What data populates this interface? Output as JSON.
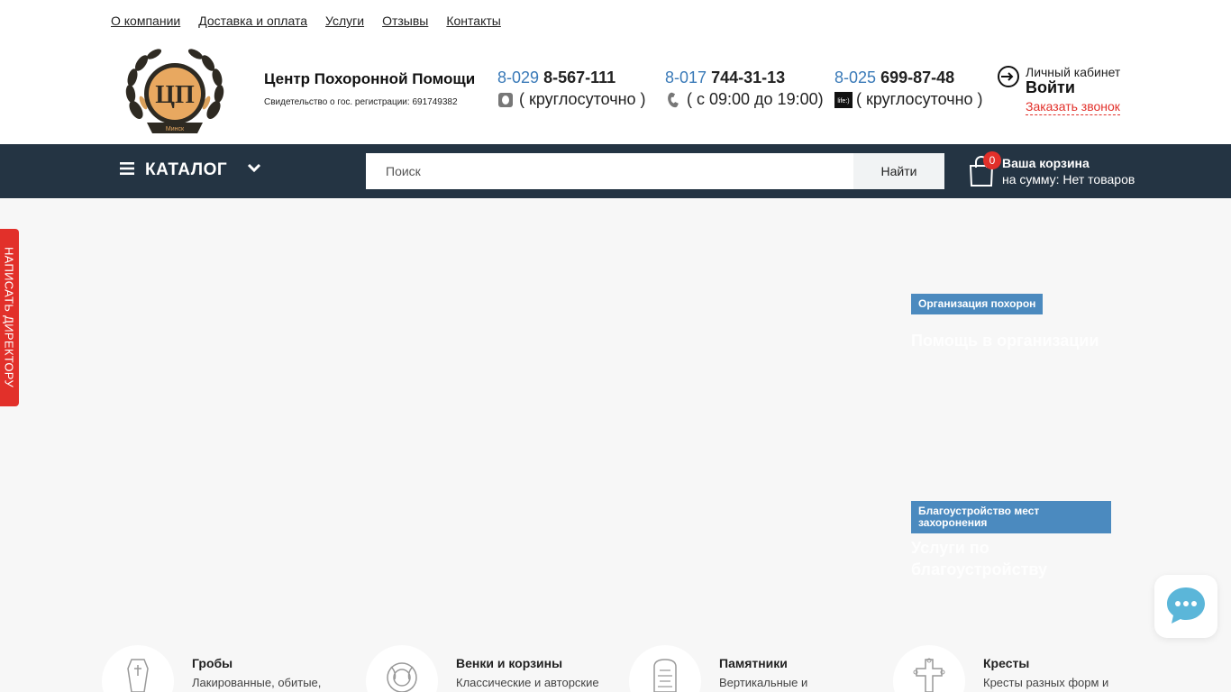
{
  "top_nav": [
    {
      "label": "О компании"
    },
    {
      "label": "Доставка и оплата"
    },
    {
      "label": "Услуги"
    },
    {
      "label": "Отзывы"
    },
    {
      "label": "Контакты"
    }
  ],
  "company": {
    "name": "Центр Похоронной Помощи",
    "registration": "Свидетельство о гос. регистрации: 691749382"
  },
  "phones": [
    {
      "code": "8-029",
      "number": "8-567-111",
      "hours": "( круглосуточно )",
      "operator_icon": "a1-operator-icon"
    },
    {
      "code": "8-017",
      "number": "744-31-13",
      "hours": "( с 09:00 до 19:00)",
      "operator_icon": "landline-phone-icon"
    },
    {
      "code": "8-025",
      "number": "699-87-48",
      "hours": "( круглосуточно )",
      "operator_icon": "life-operator-icon"
    }
  ],
  "account": {
    "label": "Личный кабинет",
    "login": "Войти",
    "callback": "Заказать звонок"
  },
  "navbar": {
    "catalog_label": "КАТАЛОГ",
    "search_placeholder": "Поиск",
    "search_button": "Найти",
    "cart_count": "0",
    "cart_title": "Ваша корзина",
    "cart_sum": "на сумму: Нет товаров"
  },
  "director_tab": "НАПИСАТЬ ДИРЕКТОРУ",
  "banner_tags": [
    {
      "tag": "Организация похорон",
      "heading": "Помощь в организации"
    },
    {
      "tag": "Благоустройство мест захоронения",
      "heading": "Услуги по благоустройству"
    }
  ],
  "categories": [
    {
      "title": "Гробы",
      "desc": "Лакированные, обитые,",
      "icon": "coffin-icon"
    },
    {
      "title": "Венки и корзины",
      "desc": "Классические и авторские",
      "icon": "wreath-icon"
    },
    {
      "title": "Памятники",
      "desc": "Вертикальные и",
      "icon": "monument-icon"
    },
    {
      "title": "Кресты",
      "desc": "Кресты разных форм и",
      "icon": "cross-icon"
    }
  ],
  "colors": {
    "navbar_bg": "#243443",
    "accent_red": "#e2302a",
    "link_blue": "#3a7ab8",
    "tag_blue": "#4b8abf"
  }
}
